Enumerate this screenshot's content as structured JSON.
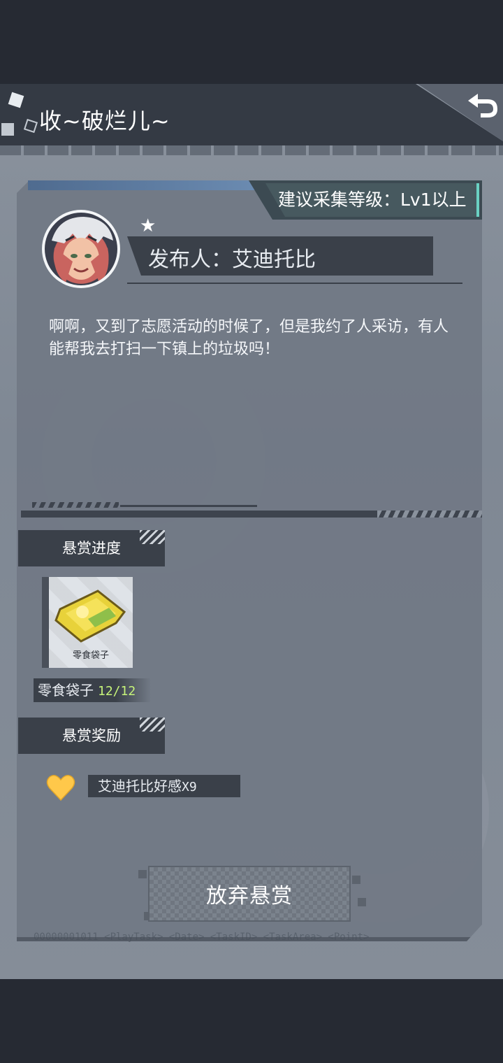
{
  "header": {
    "title": "收~破烂儿~"
  },
  "quest": {
    "level_requirement": "建议采集等级：Lv1以上",
    "publisher": "发布人：艾迪托比",
    "description": "啊啊，又到了志愿活动的时候了，但是我约了人采访，有人能帮我去打扫一下镇上的垃圾吗！"
  },
  "progress": {
    "section_label": "悬赏进度",
    "item": {
      "caption": "零食袋子",
      "name": "零食袋子",
      "count": "12/12"
    }
  },
  "reward": {
    "section_label": "悬赏奖励",
    "icon": "heart-icon",
    "name": "艾迪托比好感",
    "suffix": "X9"
  },
  "actions": {
    "abandon_label": "放弃悬赏"
  },
  "footer": {
    "text": "00000001011  <PlayTask> <Date> <TaskID> <TaskArea> <Point>"
  },
  "colors": {
    "accent_teal": "#6ad1c3",
    "count_green": "#c6f37a",
    "heart_gold": "#ffc84a"
  }
}
